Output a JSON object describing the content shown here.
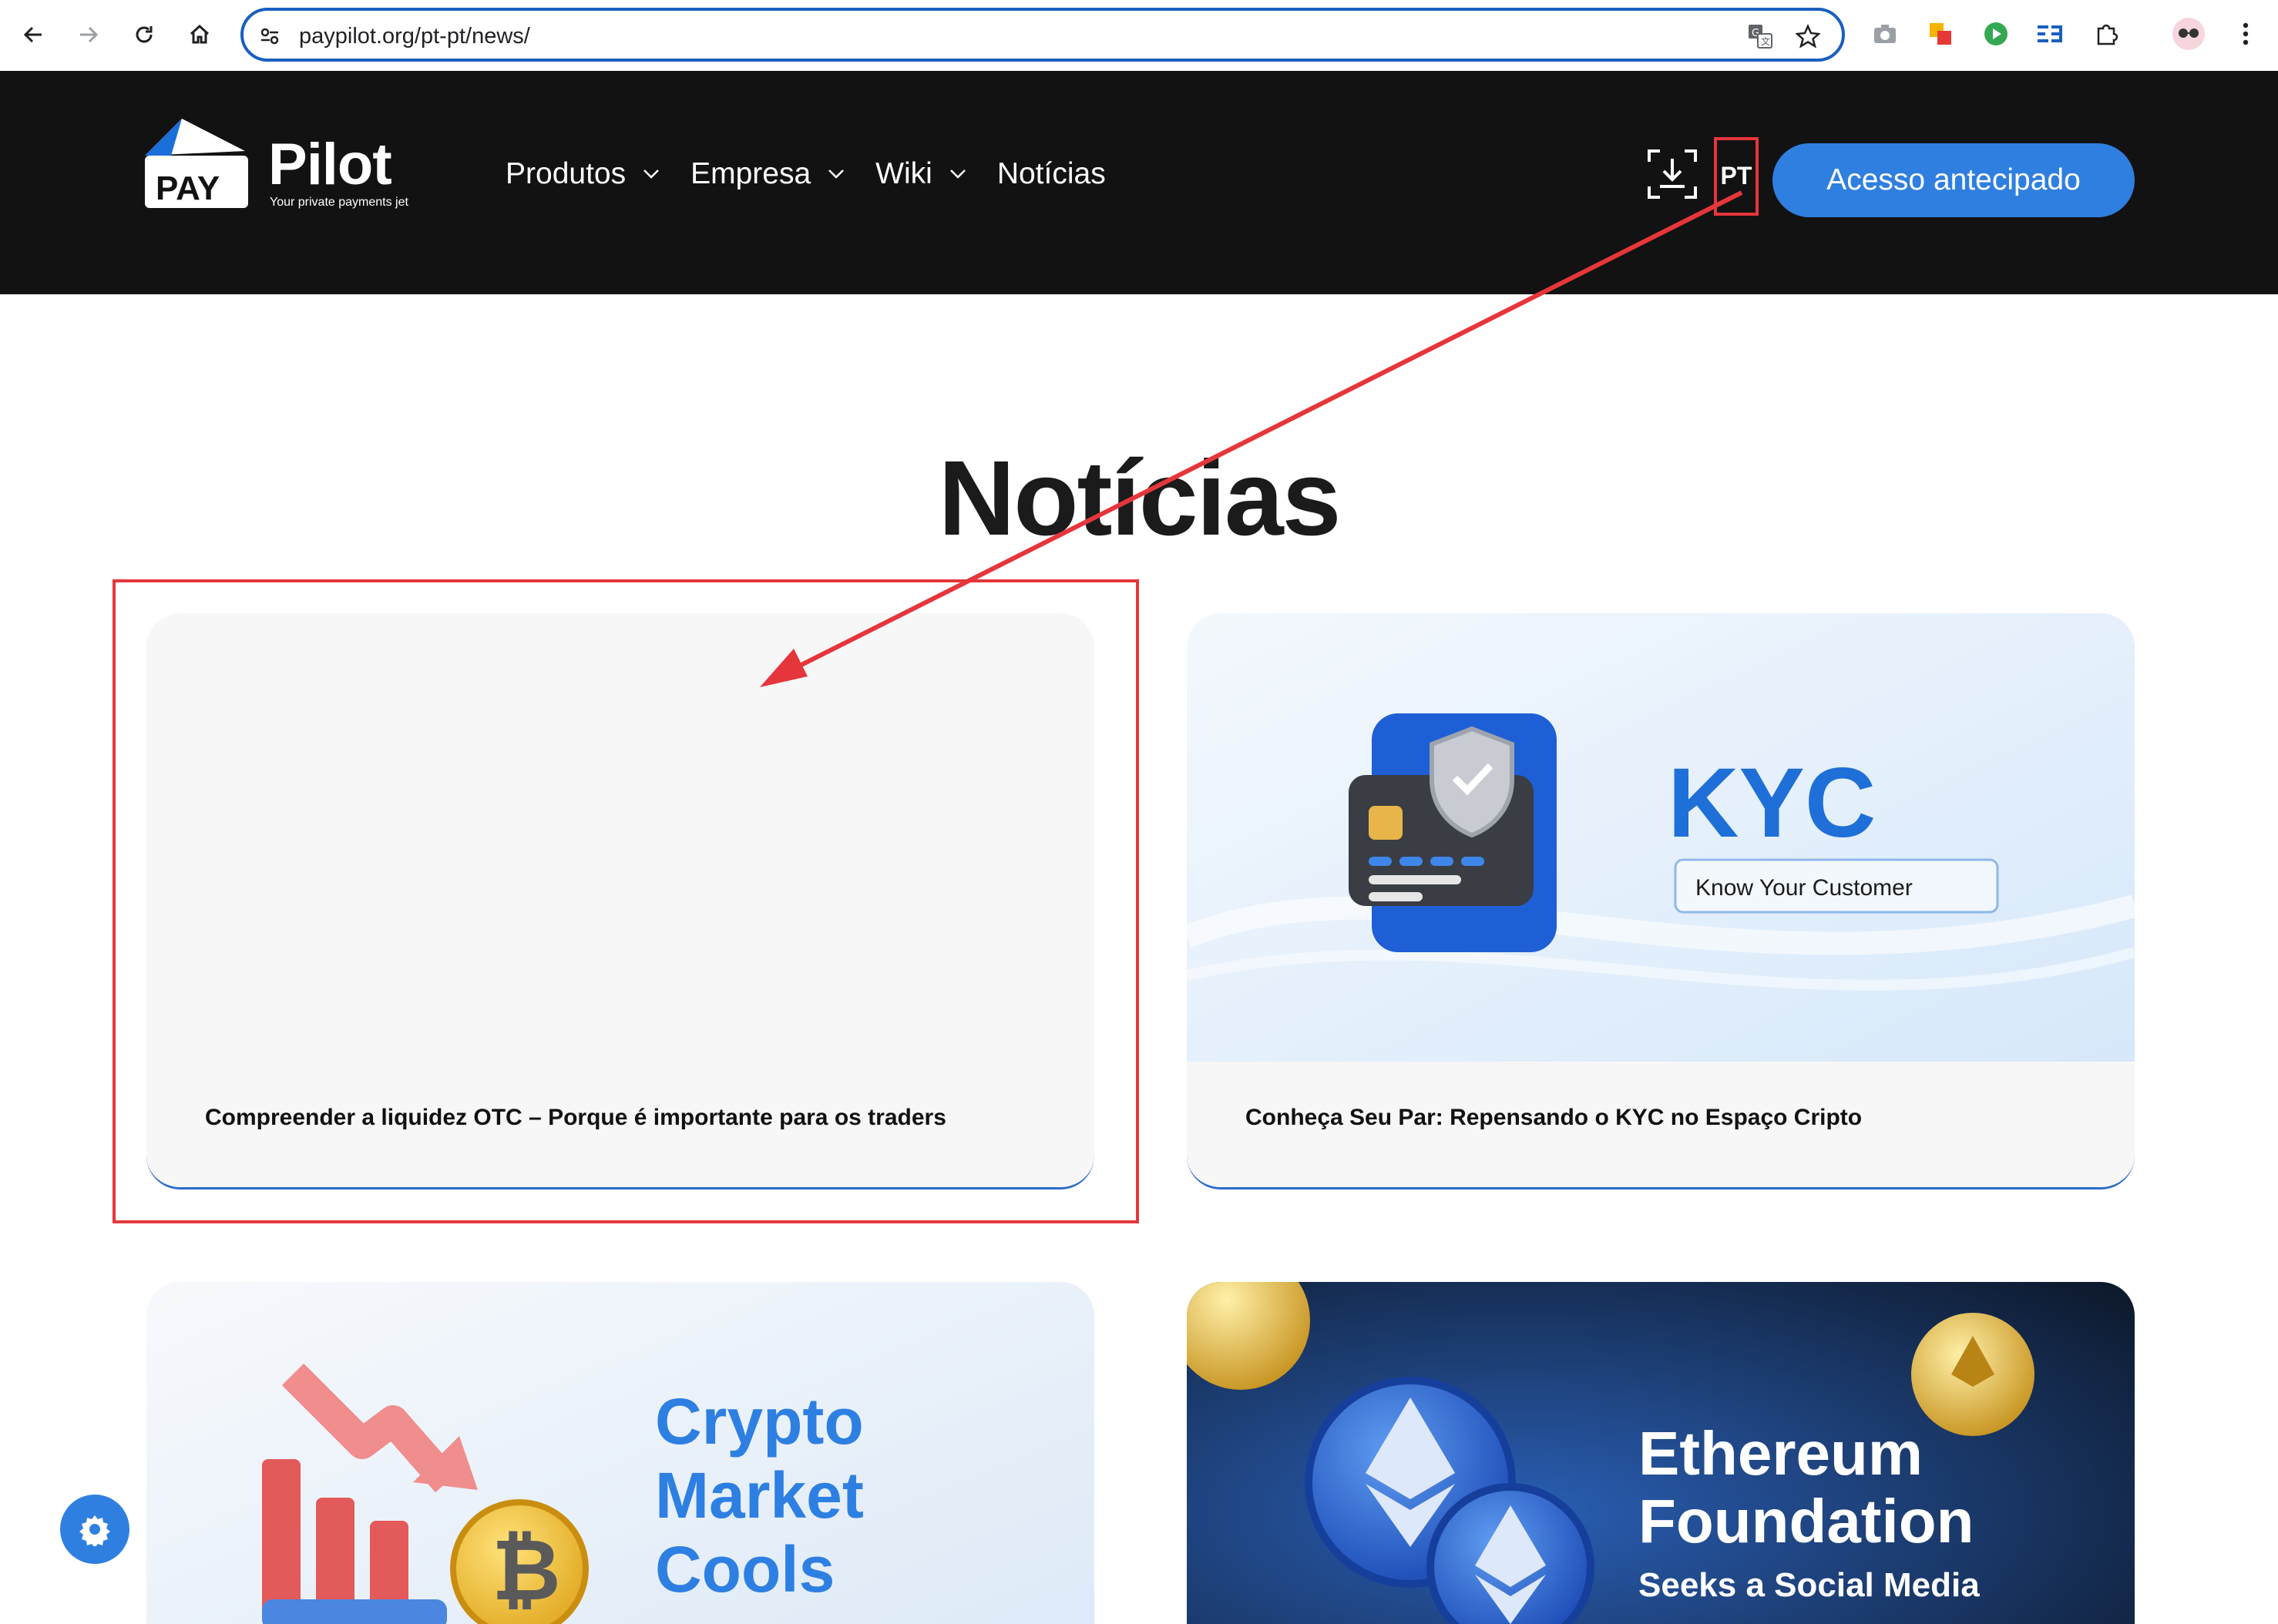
{
  "browser": {
    "url": "paypilot.org/pt-pt/news/",
    "icons": [
      "back-icon",
      "forward-icon",
      "reload-icon",
      "home-icon",
      "site-info-icon",
      "translate-icon",
      "bookmark-star-icon",
      "camera-icon",
      "extension-icon",
      "profile-icon",
      "menu-icon"
    ]
  },
  "header": {
    "brand": {
      "badge": "PAY",
      "word": "Pilot",
      "tagline": "Your private payments jet"
    },
    "menu": [
      {
        "label": "Produtos",
        "has_dropdown": true
      },
      {
        "label": "Empresa",
        "has_dropdown": true
      },
      {
        "label": "Wiki",
        "has_dropdown": true
      },
      {
        "label": "Notícias",
        "has_dropdown": false
      }
    ],
    "language": "PT",
    "cta_label": "Acesso antecipado"
  },
  "page": {
    "title": "Notícias",
    "cards": [
      {
        "caption": "Compreender a liquidez OTC – Porque é importante para os traders"
      },
      {
        "caption": "Conheça Seu Par: Repensando o KYC no Espaço Cripto",
        "image": {
          "headline": "KYC",
          "badge": "Know Your Customer"
        }
      },
      {
        "image": {
          "lines": [
            "Crypto",
            "Market",
            "Cools"
          ]
        }
      },
      {
        "image": {
          "lines": [
            "Ethereum",
            "Foundation"
          ],
          "sub": "Seeks a Social Media"
        }
      }
    ]
  },
  "colors": {
    "header_bg": "#121212",
    "accent": "#2f7fe0",
    "annotation": "#e5363b"
  }
}
